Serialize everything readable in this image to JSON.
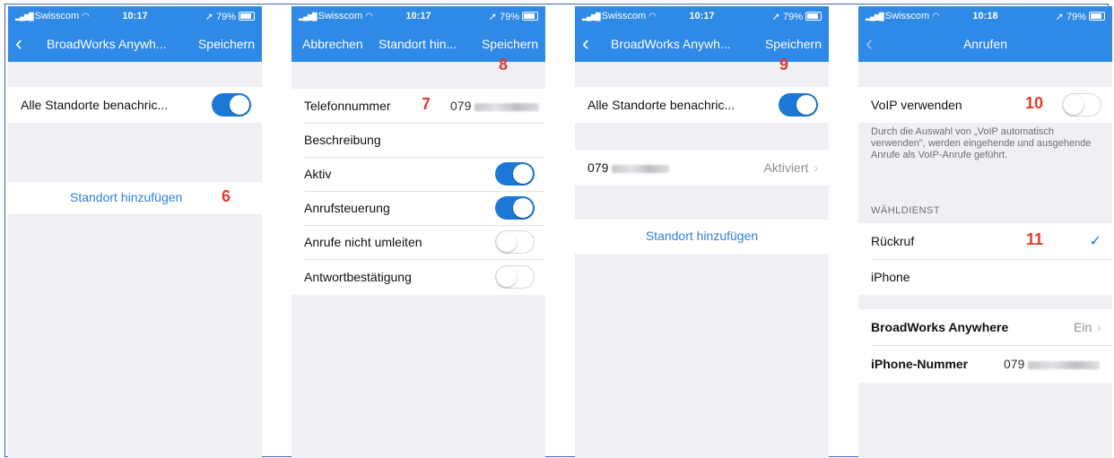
{
  "status": {
    "carrier": "Swisscom",
    "battery": "79%"
  },
  "screens": [
    {
      "time": "10:17",
      "nav": {
        "title": "BroadWorks Anywh...",
        "right": "Speichern"
      },
      "alert_label": "Alle Standorte benachric...",
      "add_location": "Standort hinzufügen",
      "annotation": "6"
    },
    {
      "time": "10:17",
      "nav": {
        "left": "Abbrechen",
        "title": "Standort hin...",
        "right": "Speichern"
      },
      "annotation_save": "8",
      "phone_label": "Telefonnummer",
      "phone_value": "079",
      "annotation_phone": "7",
      "rows": [
        "Beschreibung",
        "Aktiv",
        "Anrufsteuerung",
        "Anrufe nicht umleiten",
        "Antwortbestätigung"
      ]
    },
    {
      "time": "10:17",
      "nav": {
        "title": "BroadWorks Anywh...",
        "right": "Speichern"
      },
      "annotation_save": "9",
      "alert_label": "Alle Standorte benachric...",
      "location_number": "079",
      "location_status": "Aktiviert",
      "add_location": "Standort hinzufügen"
    },
    {
      "time": "10:18",
      "nav": {
        "title": "Anrufen"
      },
      "voip_label": "VoIP verwenden",
      "annotation_voip": "10",
      "voip_description": "Durch die Auswahl von „VoIP automatisch verwenden\", werden eingehende und ausgehende Anrufe als VoIP-Anrufe geführt.",
      "section_header": "WÄHLDIENST",
      "callback_label": "Rückruf",
      "annotation_callback": "11",
      "iphone_label": "iPhone",
      "broadworks_label": "BroadWorks Anywhere",
      "broadworks_value": "Ein",
      "iphone_number_label": "iPhone-Nummer",
      "iphone_number_value": "079"
    }
  ],
  "colors": {
    "accent": "#2f89e6",
    "toggle_on": "#1b78d6",
    "annotation": "#e23b2e",
    "background": "#efeff4"
  }
}
